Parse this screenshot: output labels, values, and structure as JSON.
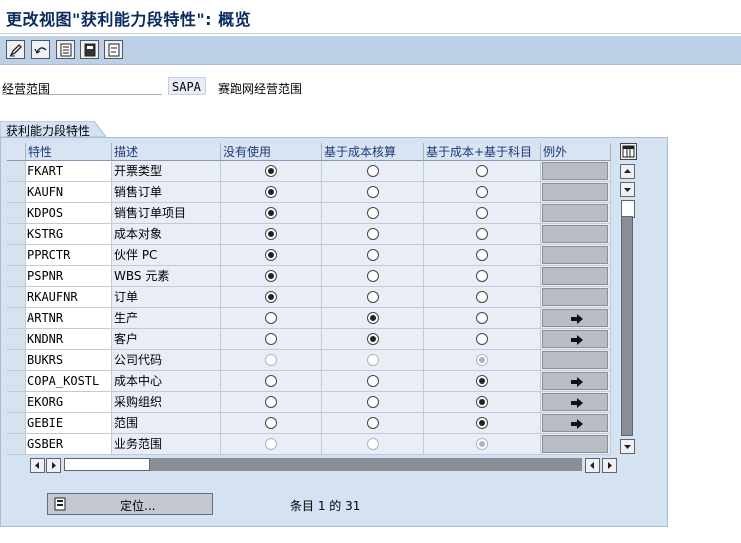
{
  "window": {
    "title": "更改视图\"获利能力段特性\": 概览"
  },
  "toolbar": {
    "buttons": [
      "edit-pencil-icon",
      "undo-icon",
      "save-icon",
      "copy-icon",
      "list-icon"
    ]
  },
  "area": {
    "label": "经营范围",
    "value": "SAPA",
    "description": "赛跑网经营范围"
  },
  "panel": {
    "title": "获利能力段特性"
  },
  "table": {
    "headers": {
      "char": "特性",
      "desc": "描述",
      "unused": "没有使用",
      "costing": "基于成本核算",
      "costing_acct": "基于成本+基于科目",
      "exception": "例外"
    },
    "rows": [
      {
        "key": "FKART",
        "desc": "开票类型",
        "choice": 0,
        "disabled": false,
        "exception_icon": false
      },
      {
        "key": "KAUFN",
        "desc": "销售订单",
        "choice": 0,
        "disabled": false,
        "exception_icon": false
      },
      {
        "key": "KDPOS",
        "desc": "销售订单项目",
        "choice": 0,
        "disabled": false,
        "exception_icon": false
      },
      {
        "key": "KSTRG",
        "desc": "成本对象",
        "choice": 0,
        "disabled": false,
        "exception_icon": false
      },
      {
        "key": "PPRCTR",
        "desc": "伙伴 PC",
        "choice": 0,
        "disabled": false,
        "exception_icon": false
      },
      {
        "key": "PSPNR",
        "desc": "WBS 元素",
        "choice": 0,
        "disabled": false,
        "exception_icon": false
      },
      {
        "key": "RKAUFNR",
        "desc": "订单",
        "choice": 0,
        "disabled": false,
        "exception_icon": false
      },
      {
        "key": "ARTNR",
        "desc": "生产",
        "choice": 1,
        "disabled": false,
        "exception_icon": true
      },
      {
        "key": "KNDNR",
        "desc": "客户",
        "choice": 1,
        "disabled": false,
        "exception_icon": true
      },
      {
        "key": "BUKRS",
        "desc": "公司代码",
        "choice": 2,
        "disabled": true,
        "exception_icon": false
      },
      {
        "key": "COPA_KOSTL",
        "desc": "成本中心",
        "choice": 2,
        "disabled": false,
        "exception_icon": true
      },
      {
        "key": "EKORG",
        "desc": "采购组织",
        "choice": 2,
        "disabled": false,
        "exception_icon": true
      },
      {
        "key": "GEBIE",
        "desc": "范围",
        "choice": 2,
        "disabled": false,
        "exception_icon": true
      },
      {
        "key": "GSBER",
        "desc": "业务范围",
        "choice": 2,
        "disabled": true,
        "exception_icon": false
      }
    ]
  },
  "footer": {
    "position_button": "定位...",
    "entry_count": "条目 1 的 31"
  }
}
